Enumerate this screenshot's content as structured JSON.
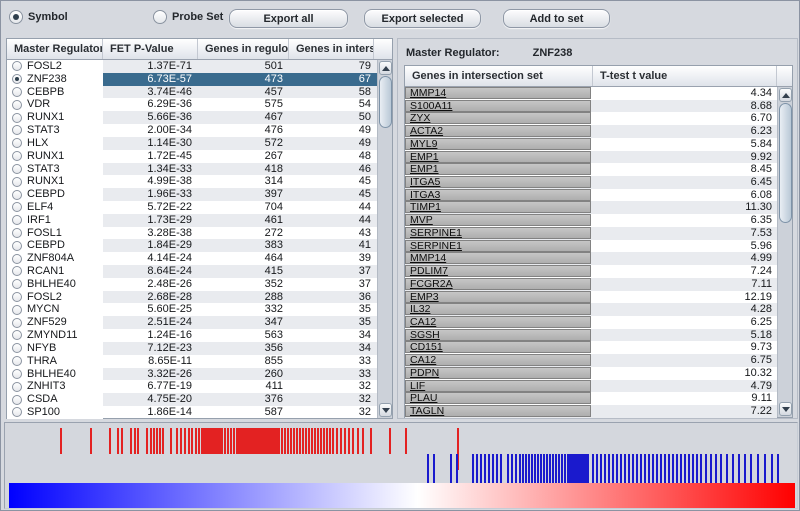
{
  "toolbar": {
    "radio_symbol": "Symbol",
    "radio_probe_set": "Probe Set",
    "export_all": "Export all",
    "export_selected": "Export selected",
    "add_to_set": "Add to set",
    "symbol_selected": true
  },
  "left_table": {
    "columns": [
      "Master Regulator",
      "FET P-Value",
      "Genes in regulon",
      "Genes in interse..."
    ],
    "selected_index": 1,
    "rows": [
      [
        "FOSL2",
        "1.37E-71",
        "501",
        "79"
      ],
      [
        "ZNF238",
        "6.73E-57",
        "473",
        "67"
      ],
      [
        "CEBPB",
        "3.74E-46",
        "457",
        "58"
      ],
      [
        "VDR",
        "6.29E-36",
        "575",
        "54"
      ],
      [
        "RUNX1",
        "5.66E-36",
        "467",
        "50"
      ],
      [
        "STAT3",
        "2.00E-34",
        "476",
        "49"
      ],
      [
        "HLX",
        "1.14E-30",
        "572",
        "49"
      ],
      [
        "RUNX1",
        "1.72E-45",
        "267",
        "48"
      ],
      [
        "STAT3",
        "1.34E-33",
        "418",
        "46"
      ],
      [
        "RUNX1",
        "4.99E-38",
        "314",
        "45"
      ],
      [
        "CEBPD",
        "1.96E-33",
        "397",
        "45"
      ],
      [
        "ELF4",
        "5.72E-22",
        "704",
        "44"
      ],
      [
        "IRF1",
        "1.73E-29",
        "461",
        "44"
      ],
      [
        "FOSL1",
        "3.28E-38",
        "272",
        "43"
      ],
      [
        "CEBPD",
        "1.84E-29",
        "383",
        "41"
      ],
      [
        "ZNF804A",
        "4.14E-24",
        "464",
        "39"
      ],
      [
        "RCAN1",
        "8.64E-24",
        "415",
        "37"
      ],
      [
        "BHLHE40",
        "2.48E-26",
        "352",
        "37"
      ],
      [
        "FOSL2",
        "2.68E-28",
        "288",
        "36"
      ],
      [
        "MYCN",
        "5.60E-25",
        "332",
        "35"
      ],
      [
        "ZNF529",
        "2.51E-24",
        "347",
        "35"
      ],
      [
        "ZMYND11",
        "1.24E-16",
        "563",
        "34"
      ],
      [
        "NFYB",
        "7.12E-23",
        "356",
        "34"
      ],
      [
        "THRA",
        "8.65E-11",
        "855",
        "33"
      ],
      [
        "BHLHE40",
        "3.32E-26",
        "260",
        "33"
      ],
      [
        "ZNHIT3",
        "6.77E-19",
        "411",
        "32"
      ],
      [
        "CSDA",
        "4.75E-20",
        "376",
        "32"
      ],
      [
        "SP100",
        "1.86E-14",
        "587",
        "32"
      ]
    ]
  },
  "right_panel": {
    "title_label": "Master Regulator:",
    "title_value": "ZNF238",
    "columns": [
      "Genes in intersection set",
      "T-test t value"
    ],
    "rows": [
      [
        "MMP14",
        "4.34"
      ],
      [
        "S100A11",
        "8.68"
      ],
      [
        "ZYX",
        "6.70"
      ],
      [
        "ACTA2",
        "6.23"
      ],
      [
        "MYL9",
        "5.84"
      ],
      [
        "EMP1",
        "9.92"
      ],
      [
        "EMP1",
        "8.45"
      ],
      [
        "ITGA5",
        "6.45"
      ],
      [
        "ITGA3",
        "6.08"
      ],
      [
        "TIMP1",
        "11.30"
      ],
      [
        "MVP",
        "6.35"
      ],
      [
        "SERPINE1",
        "7.53"
      ],
      [
        "SERPINE1",
        "5.96"
      ],
      [
        "MMP14",
        "4.99"
      ],
      [
        "PDLIM7",
        "7.24"
      ],
      [
        "FCGR2A",
        "7.11"
      ],
      [
        "EMP3",
        "12.19"
      ],
      [
        "IL32",
        "4.28"
      ],
      [
        "CA12",
        "6.25"
      ],
      [
        "SGSH",
        "5.18"
      ],
      [
        "CD151",
        "9.73"
      ],
      [
        "CA12",
        "6.75"
      ],
      [
        "PDPN",
        "10.32"
      ],
      [
        "LIF",
        "4.79"
      ],
      [
        "PLAU",
        "9.11"
      ],
      [
        "TAGLN",
        "7.22"
      ]
    ]
  },
  "plot": {
    "type": "barcode-strips-with-gradient",
    "tick_red_color": "#e32222",
    "tick_blue_color": "#1a1acd",
    "gradient_colors": [
      "#0000ff",
      "#ffffff",
      "#ff0000"
    ],
    "gradient_white_stop_pct": 52,
    "red_ticks": [
      55,
      85,
      104,
      112,
      116,
      125,
      129,
      132,
      141,
      145,
      148,
      151,
      154,
      157,
      165,
      171,
      175,
      179,
      183,
      186,
      190,
      193,
      196,
      198,
      200,
      202,
      204,
      206,
      208,
      210,
      212,
      214,
      216,
      219,
      222,
      225,
      228,
      231,
      233,
      235,
      237,
      238,
      239,
      240,
      241,
      243,
      245,
      247,
      249,
      251,
      253,
      255,
      257,
      259,
      261,
      263,
      265,
      267,
      269,
      271,
      273,
      276,
      279,
      282,
      285,
      288,
      291,
      294,
      297,
      300,
      303,
      306,
      309,
      312,
      315,
      318,
      321,
      324,
      327,
      331,
      335,
      339,
      343,
      347,
      352,
      357,
      365,
      384,
      400,
      452
    ],
    "blue_ticks": [
      422,
      428,
      445,
      451,
      467,
      471,
      475,
      479,
      483,
      487,
      491,
      495,
      502,
      506,
      510,
      514,
      517,
      520,
      523,
      526,
      529,
      532,
      535,
      538,
      541,
      544,
      547,
      550,
      553,
      556,
      559,
      562,
      564,
      566,
      568,
      570,
      572,
      574,
      576,
      578,
      580,
      582,
      587,
      591,
      595,
      599,
      603,
      607,
      611,
      615,
      619,
      623,
      627,
      631,
      635,
      639,
      643,
      647,
      651,
      655,
      659,
      663,
      667,
      671,
      675,
      679,
      683,
      687,
      691,
      695,
      700,
      705,
      710,
      715,
      721,
      727,
      733,
      739,
      745,
      752,
      759,
      766,
      772
    ]
  },
  "colors": {
    "selection": "#3a6b8e",
    "stripe": "#e9ebef",
    "panel_bg": "#d6d9df"
  }
}
